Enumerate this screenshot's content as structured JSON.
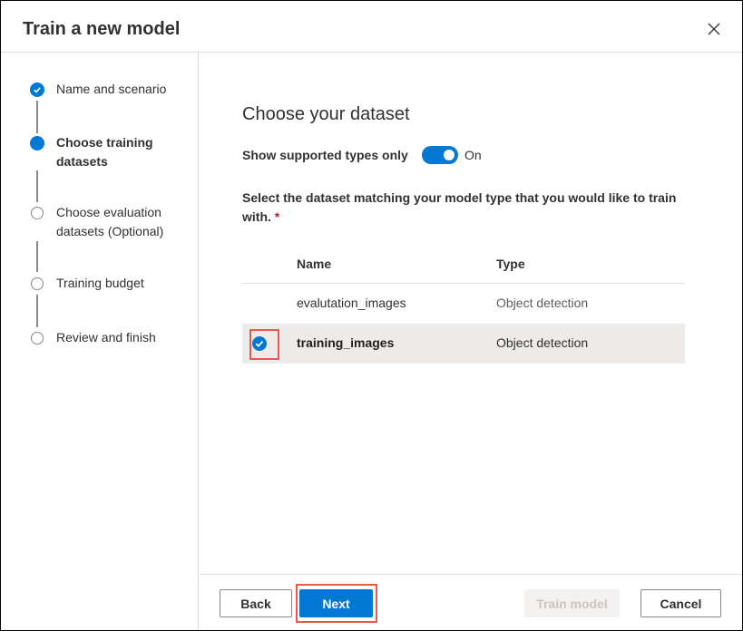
{
  "dialog": {
    "title": "Train a new model",
    "close_icon": "close-icon"
  },
  "steps": [
    {
      "label": "Name and scenario",
      "state": "completed",
      "icon": "checkmark-circle-icon"
    },
    {
      "label": "Choose training datasets",
      "state": "current",
      "icon": "filled-circle-icon"
    },
    {
      "label": "Choose evaluation datasets (Optional)",
      "state": "pending",
      "icon": "empty-circle-icon"
    },
    {
      "label": "Training budget",
      "state": "pending",
      "icon": "empty-circle-icon"
    },
    {
      "label": "Review and finish",
      "state": "pending",
      "icon": "empty-circle-icon"
    }
  ],
  "main": {
    "heading": "Choose your dataset",
    "toggle": {
      "label": "Show supported types only",
      "state_text": "On",
      "checked": true
    },
    "instruction": "Select the dataset matching your model type that you would like to train with.",
    "required_marker": "*",
    "table": {
      "columns": [
        "Name",
        "Type"
      ],
      "rows": [
        {
          "name": "evalutation_images",
          "type": "Object detection",
          "selected": false
        },
        {
          "name": "training_images",
          "type": "Object detection",
          "selected": true
        }
      ]
    }
  },
  "footer": {
    "back_label": "Back",
    "next_label": "Next",
    "train_label": "Train model",
    "cancel_label": "Cancel"
  },
  "colors": {
    "accent": "#0078d4",
    "highlight": "#e8584a",
    "selected_row": "#edebe9"
  }
}
